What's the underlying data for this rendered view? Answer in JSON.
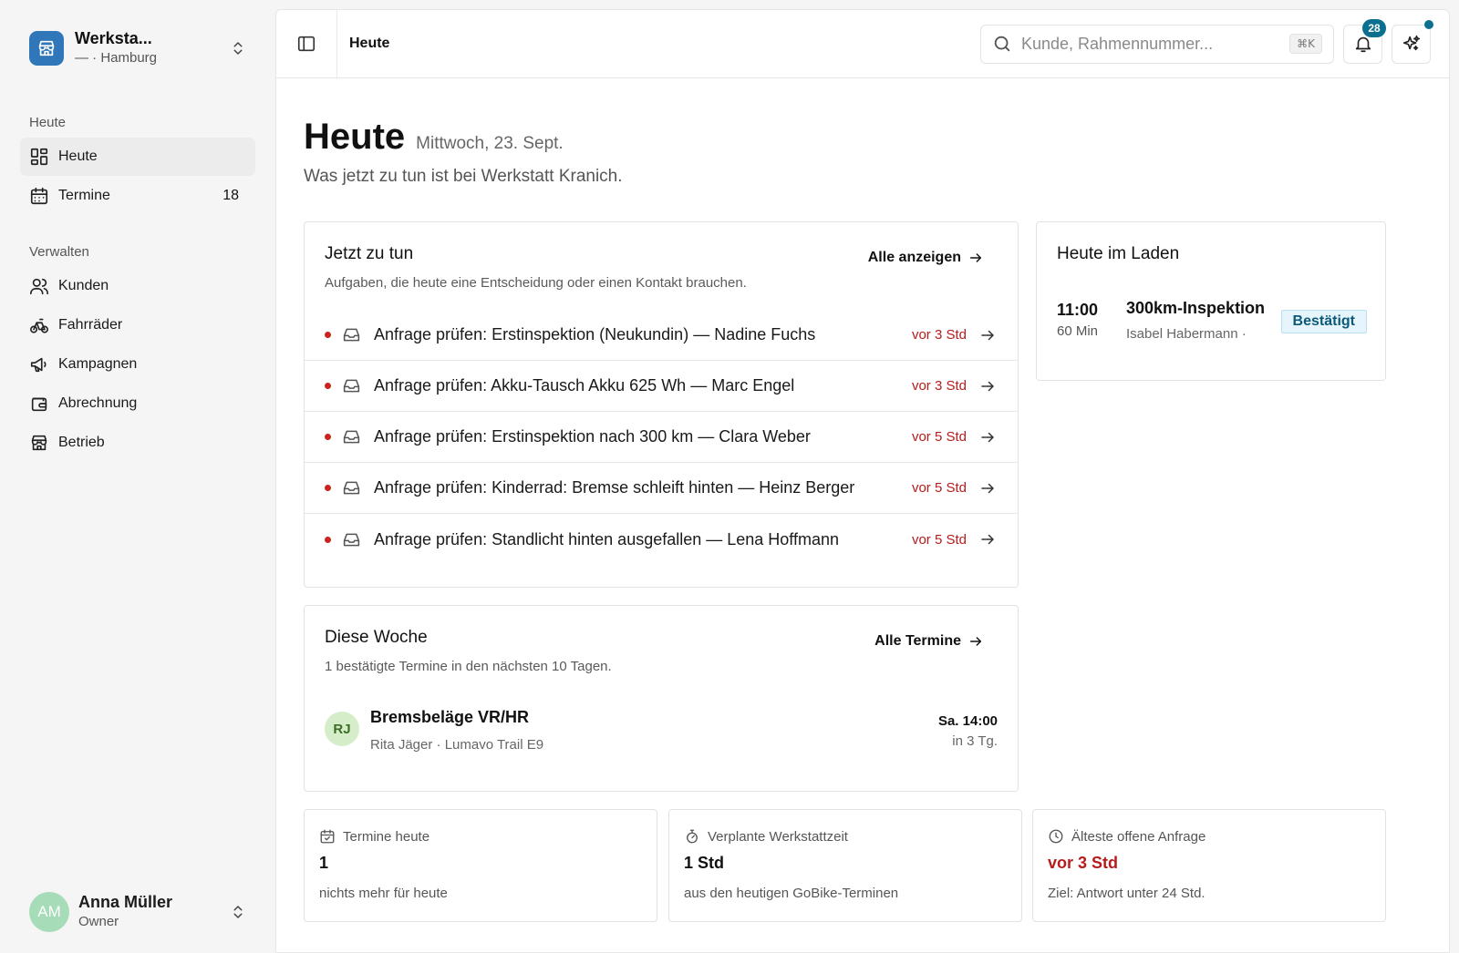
{
  "sidebar": {
    "brand_name": "Werksta...",
    "brand_sub": "— · Hamburg",
    "section_today": "Heute",
    "section_manage": "Verwalten",
    "items": [
      {
        "label": "Heute",
        "count": ""
      },
      {
        "label": "Termine",
        "count": "18"
      },
      {
        "label": "Kunden",
        "count": ""
      },
      {
        "label": "Fahrräder",
        "count": ""
      },
      {
        "label": "Kampagnen",
        "count": ""
      },
      {
        "label": "Abrechnung",
        "count": ""
      },
      {
        "label": "Betrieb",
        "count": ""
      }
    ],
    "user": {
      "initials": "AM",
      "name": "Anna Müller",
      "role": "Owner"
    }
  },
  "topbar": {
    "breadcrumb": "Heute",
    "search_placeholder": "Kunde, Rahmennummer...",
    "search_shortcut": "⌘K",
    "notification_count": "28"
  },
  "page": {
    "title": "Heute",
    "date": "Mittwoch, 23. Sept.",
    "subtitle": "Was jetzt zu tun ist bei Werkstatt Kranich."
  },
  "tasks": {
    "title": "Jetzt zu tun",
    "description": "Aufgaben, die heute eine Entscheidung oder einen Kontakt brauchen.",
    "link": "Alle anzeigen",
    "items": [
      {
        "title": "Anfrage prüfen: Erstinspektion (Neukundin) — Nadine Fuchs",
        "age": "vor 3 Std"
      },
      {
        "title": "Anfrage prüfen: Akku-Tausch Akku 625 Wh — Marc Engel",
        "age": "vor 3 Std"
      },
      {
        "title": "Anfrage prüfen: Erstinspektion nach 300 km — Clara Weber",
        "age": "vor 5 Std"
      },
      {
        "title": "Anfrage prüfen: Kinderrad: Bremse schleift hinten — Heinz Berger",
        "age": "vor 5 Std"
      },
      {
        "title": "Anfrage prüfen: Standlicht hinten ausgefallen — Lena Hoffmann",
        "age": "vor 5 Std"
      }
    ]
  },
  "today_in_store": {
    "title": "Heute im Laden",
    "appointment": {
      "time": "11:00",
      "duration": "60 Min",
      "service": "300km-Inspektion",
      "customer": "Isabel Habermann ·",
      "status": "Bestätigt"
    }
  },
  "this_week": {
    "title": "Diese Woche",
    "description": "1 bestätigte Termine in den nächsten 10 Tagen.",
    "link": "Alle Termine",
    "item": {
      "initials": "RJ",
      "service": "Bremsbeläge VR/HR",
      "details": "Rita Jäger · Lumavo Trail E9",
      "when": "Sa. 14:00",
      "relative": "in 3 Tg."
    }
  },
  "stats": [
    {
      "label": "Termine heute",
      "value": "1",
      "note": "nichts mehr für heute",
      "icon": "calendar-check-icon"
    },
    {
      "label": "Verplante Werkstattzeit",
      "value": "1 Std",
      "note": "aus den heutigen GoBike-Terminen",
      "icon": "stopwatch-icon"
    },
    {
      "label": "Älteste offene Anfrage",
      "value": "vor 3 Std",
      "note": "Ziel: Antwort unter 24 Std.",
      "icon": "clock-icon"
    }
  ],
  "colors": {
    "accent": "#0b6f8f",
    "brand_logo": "#2f77b8",
    "urgent": "#b71c1c",
    "status_confirmed_bg": "#e6f4fb"
  }
}
